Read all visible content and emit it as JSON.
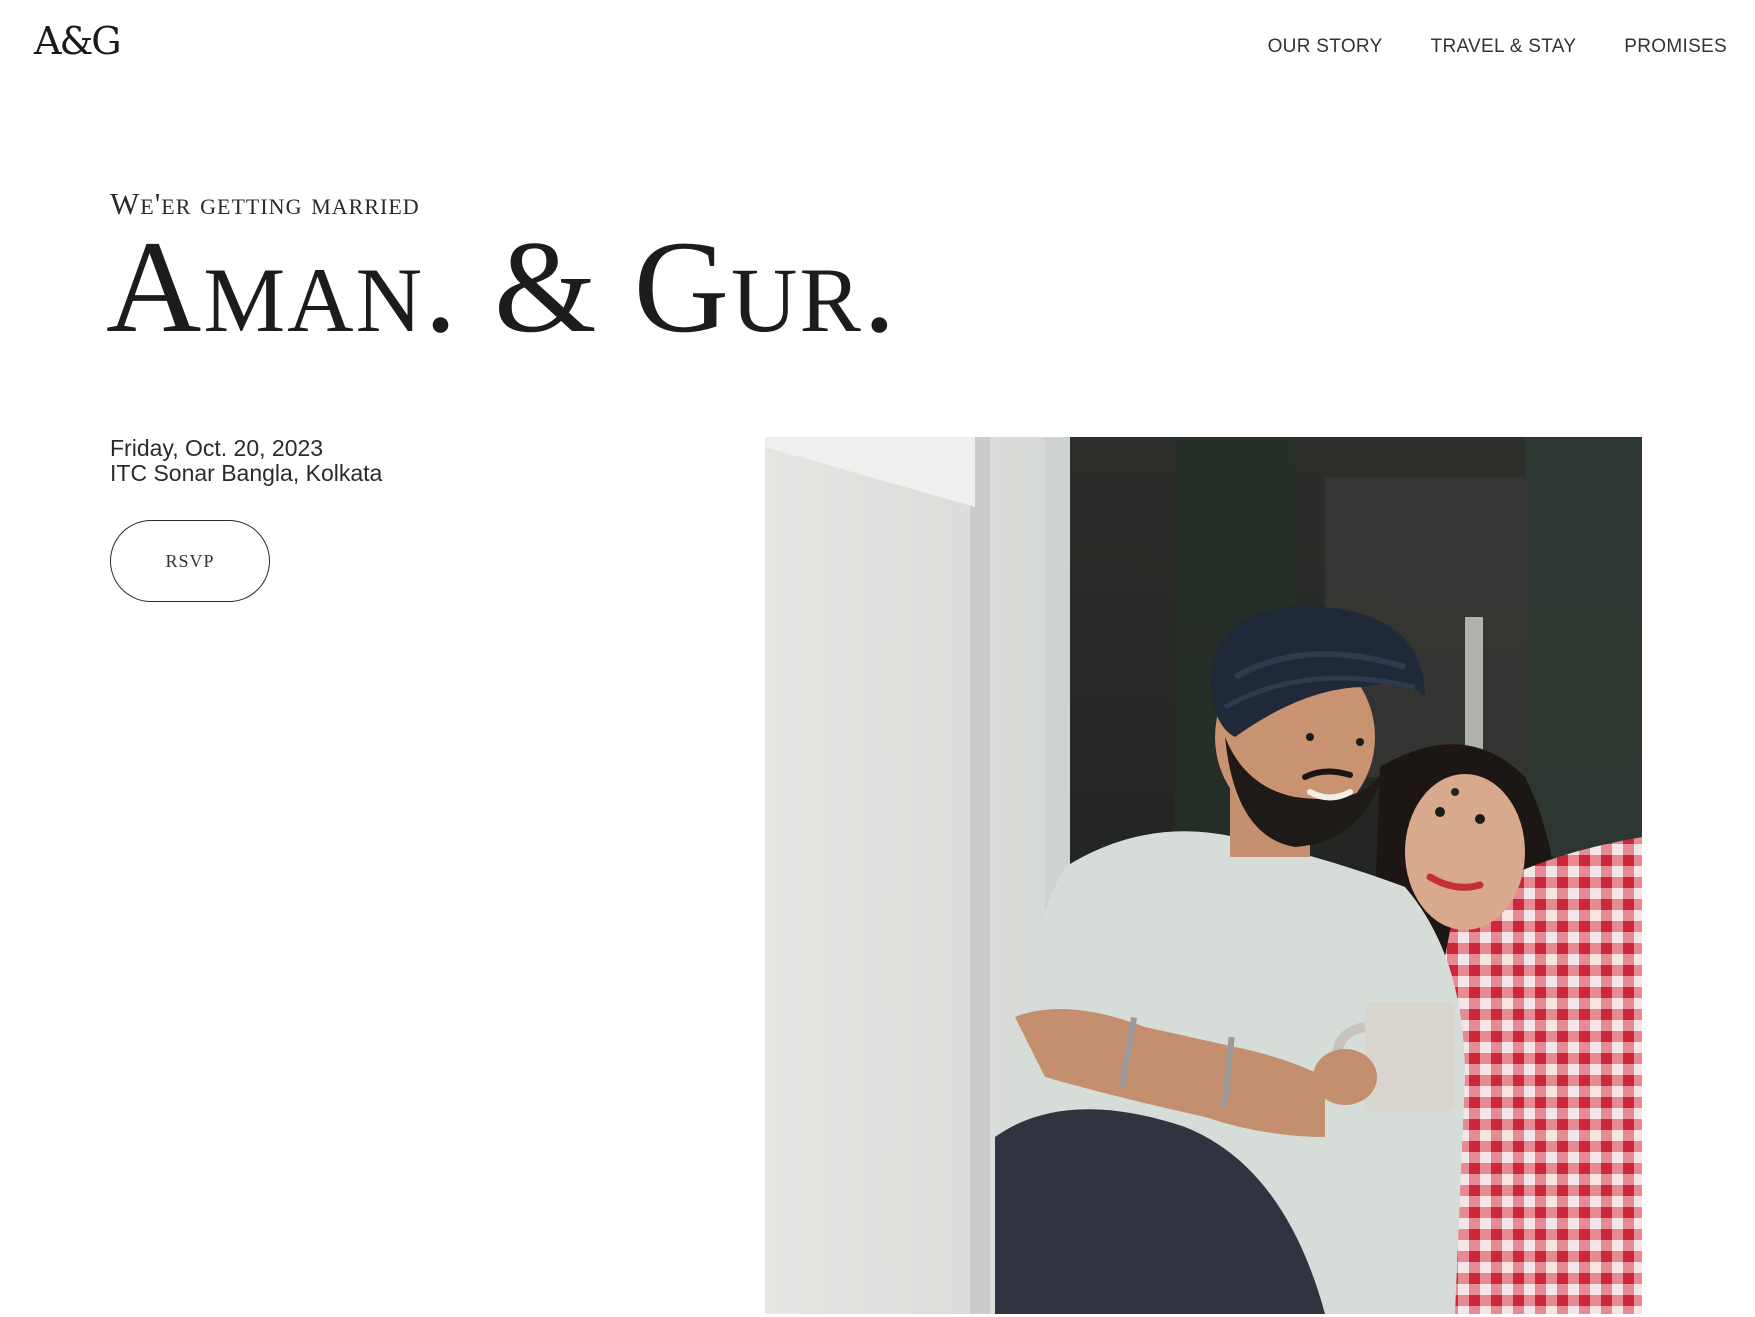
{
  "header": {
    "logo": "A&G",
    "nav": [
      {
        "label": "OUR STORY"
      },
      {
        "label": "TRAVEL & STAY"
      },
      {
        "label": "PROMISES"
      }
    ]
  },
  "hero": {
    "eyebrow": "We'er getting married",
    "couple_names": "Aman. & Gur.",
    "date": "Friday, Oct. 20, 2023",
    "venue": "ITC Sonar Bangla, Kolkata",
    "rsvp_label": "RSVP"
  },
  "photo": {
    "subject": "couple-photo"
  },
  "colors": {
    "text": "#222222",
    "background": "#ffffff",
    "turban": "#1f2937",
    "shirt": "#d6ddd8",
    "checks": "#d9394a"
  }
}
